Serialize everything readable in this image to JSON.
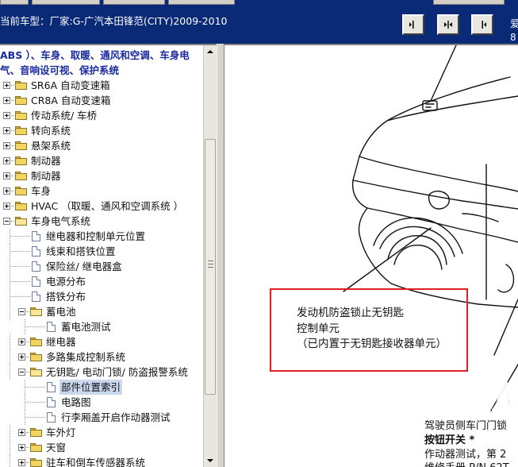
{
  "header": {
    "vehicle_label": "当前车型：厂家:G-广汽本田锋范(CITY)2009-2010",
    "side_text": [
      "爱",
      "8"
    ],
    "nav_buttons": [
      {
        "name": "nav-prev-button",
        "icon": "step-left-icon"
      },
      {
        "name": "nav-both-button",
        "icon": "split-arrows-icon"
      },
      {
        "name": "nav-next-button",
        "icon": "step-right-icon"
      }
    ]
  },
  "tree": {
    "header_lines": [
      "ABS ）、车身、取暖、通风和空调、车身电",
      "气、音响设可视、保护系统"
    ],
    "items": [
      {
        "label": "SR6A 自动变速箱",
        "depth": 0,
        "type": "folder",
        "toggle": "plus"
      },
      {
        "label": "CR8A 自动变速箱",
        "depth": 0,
        "type": "folder",
        "toggle": "plus"
      },
      {
        "label": "传动系统/ 车桥",
        "depth": 0,
        "type": "folder",
        "toggle": "plus"
      },
      {
        "label": "转向系统",
        "depth": 0,
        "type": "folder",
        "toggle": "plus"
      },
      {
        "label": "悬架系统",
        "depth": 0,
        "type": "folder",
        "toggle": "plus"
      },
      {
        "label": "制动器",
        "depth": 0,
        "type": "folder",
        "toggle": "plus"
      },
      {
        "label": "制动器",
        "depth": 0,
        "type": "folder",
        "toggle": "plus"
      },
      {
        "label": "车身",
        "depth": 0,
        "type": "folder",
        "toggle": "plus"
      },
      {
        "label": "HVAC （取暖、通风和空调系统 ）",
        "depth": 0,
        "type": "folder",
        "toggle": "plus"
      },
      {
        "label": "车身电气系统",
        "depth": 0,
        "type": "folder-open",
        "toggle": "minus"
      },
      {
        "label": "继电器和控制单元位置",
        "depth": 1,
        "type": "doc"
      },
      {
        "label": "线束和搭铁位置",
        "depth": 1,
        "type": "doc"
      },
      {
        "label": "保险丝/ 继电器盒",
        "depth": 1,
        "type": "doc"
      },
      {
        "label": "电源分布",
        "depth": 1,
        "type": "doc"
      },
      {
        "label": "搭铁分布",
        "depth": 1,
        "type": "doc"
      },
      {
        "label": "蓄电池",
        "depth": 1,
        "type": "folder-open",
        "toggle": "minus"
      },
      {
        "label": "蓄电池测试",
        "depth": 2,
        "type": "doc"
      },
      {
        "label": "继电器",
        "depth": 1,
        "type": "folder",
        "toggle": "plus"
      },
      {
        "label": "多路集成控制系统",
        "depth": 1,
        "type": "folder",
        "toggle": "plus"
      },
      {
        "label": "无钥匙/ 电动门锁/ 防盗报警系统",
        "depth": 1,
        "type": "folder-open",
        "toggle": "minus"
      },
      {
        "label": "部件位置索引",
        "depth": 2,
        "type": "doc",
        "selected": true
      },
      {
        "label": "电路图",
        "depth": 2,
        "type": "doc"
      },
      {
        "label": "行李厢盖开启作动器测试",
        "depth": 2,
        "type": "doc"
      },
      {
        "label": "车外灯",
        "depth": 1,
        "type": "folder",
        "toggle": "plus"
      },
      {
        "label": "天窗",
        "depth": 1,
        "type": "folder",
        "toggle": "plus"
      },
      {
        "label": "驻车和倒车传感器系统",
        "depth": 1,
        "type": "folder",
        "toggle": "plus"
      }
    ]
  },
  "diagram": {
    "callout_lines": [
      "发动机防盗锁止无钥匙",
      "控制单元",
      "（已内置于无钥匙接收器单元）"
    ],
    "side_lines": [
      "驾驶员侧车门门锁",
      "按钮开关 *",
      "作动器测试，第 2",
      "维修手册 P/N 62T"
    ],
    "watermark": "畅",
    "accent_color": "#e02020"
  }
}
